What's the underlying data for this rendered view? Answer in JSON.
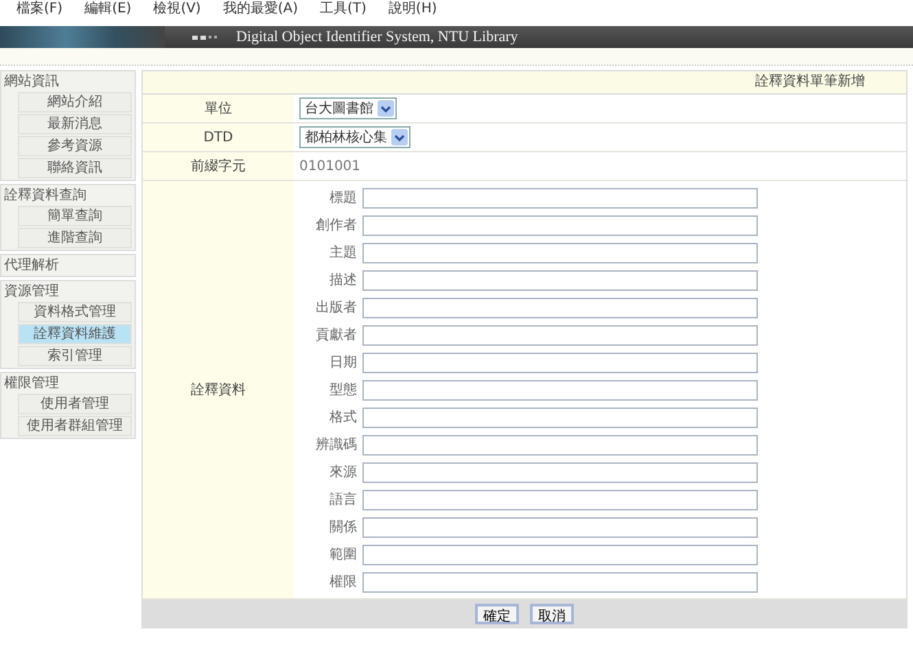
{
  "menu_bar": [
    "檔案(F)",
    "編輯(E)",
    "檢視(V)",
    "我的最愛(A)",
    "工具(T)",
    "說明(H)"
  ],
  "header": {
    "title": "Digital Object Identifier System, NTU Library"
  },
  "sidebar": [
    {
      "heading": "網站資訊",
      "items": [
        {
          "label": "網站介紹",
          "selected": false
        },
        {
          "label": "最新消息",
          "selected": false
        },
        {
          "label": "參考資源",
          "selected": false
        },
        {
          "label": "聯絡資訊",
          "selected": false
        }
      ]
    },
    {
      "heading": "詮釋資料查詢",
      "items": [
        {
          "label": "簡單查詢",
          "selected": false
        },
        {
          "label": "進階查詢",
          "selected": false
        }
      ]
    },
    {
      "heading": "代理解析"
    },
    {
      "heading": "資源管理",
      "items": [
        {
          "label": "資料格式管理",
          "selected": false
        },
        {
          "label": "詮釋資料維護",
          "selected": true
        },
        {
          "label": "索引管理",
          "selected": false
        }
      ]
    },
    {
      "heading": "權限管理",
      "items": [
        {
          "label": "使用者管理",
          "selected": false
        },
        {
          "label": "使用者群組管理",
          "selected": false
        }
      ]
    }
  ],
  "form": {
    "title": "詮釋資料單筆新增",
    "rows": [
      {
        "label": "單位",
        "kind": "select",
        "value": "台大圖書館"
      },
      {
        "label": "DTD",
        "kind": "select",
        "value": "都柏林核心集"
      },
      {
        "label": "前綴字元",
        "kind": "text",
        "value": "0101001"
      }
    ],
    "metadata_label": "詮釋資料",
    "fields": [
      "標題",
      "創作者",
      "主題",
      "描述",
      "出版者",
      "貢獻者",
      "日期",
      "型態",
      "格式",
      "辨識碼",
      "來源",
      "語言",
      "關係",
      "範圍",
      "權限"
    ],
    "buttons": [
      "確定",
      "取消"
    ]
  }
}
